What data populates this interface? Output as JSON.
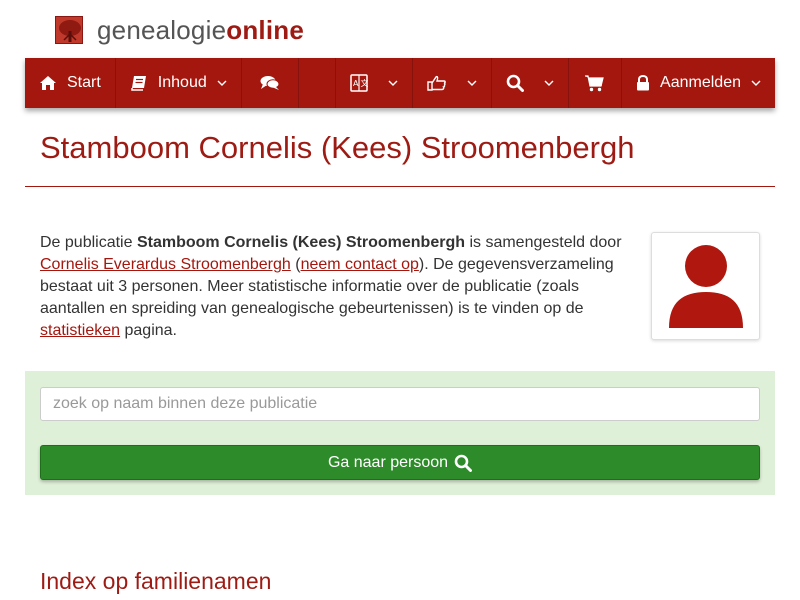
{
  "logo": {
    "text_plain": "genealogie",
    "text_bold": "online"
  },
  "nav": {
    "start_label": "Start",
    "inhoud_label": "Inhoud",
    "aanmelden_label": "Aanmelden"
  },
  "page": {
    "title": "Stamboom Cornelis (Kees) Stroomenbergh",
    "intro": {
      "part1": "De publicatie ",
      "publication_name": "Stamboom Cornelis (Kees) Stroomenbergh",
      "part2": " is samengesteld door ",
      "author_link": "Cornelis Everardus Stroomenbergh",
      "part3": " (",
      "contact_link": "neem contact op",
      "part4": "). De gegevensverzameling bestaat uit 3 personen. Meer statistische informatie over de publicatie (zoals aantallen en spreiding van genealogische gebeurtenissen) is te vinden op de ",
      "stats_link": "statistieken",
      "part5": " pagina."
    }
  },
  "search": {
    "placeholder": "zoek op naam binnen deze publicatie",
    "value": "",
    "button_label": "Ga naar persoon"
  },
  "index": {
    "heading": "Index op familienamen"
  },
  "colors": {
    "brand": "#a4170e",
    "title": "#9e1b14",
    "panel": "#dff0d8",
    "button": "#2e8b2a"
  },
  "icons": [
    "tree-logo-icon",
    "home-icon",
    "book-icon",
    "comments-icon",
    "language-icon",
    "thumbs-up-icon",
    "search-icon",
    "cart-icon",
    "lock-icon",
    "chevron-down-icon",
    "user-avatar-icon"
  ]
}
